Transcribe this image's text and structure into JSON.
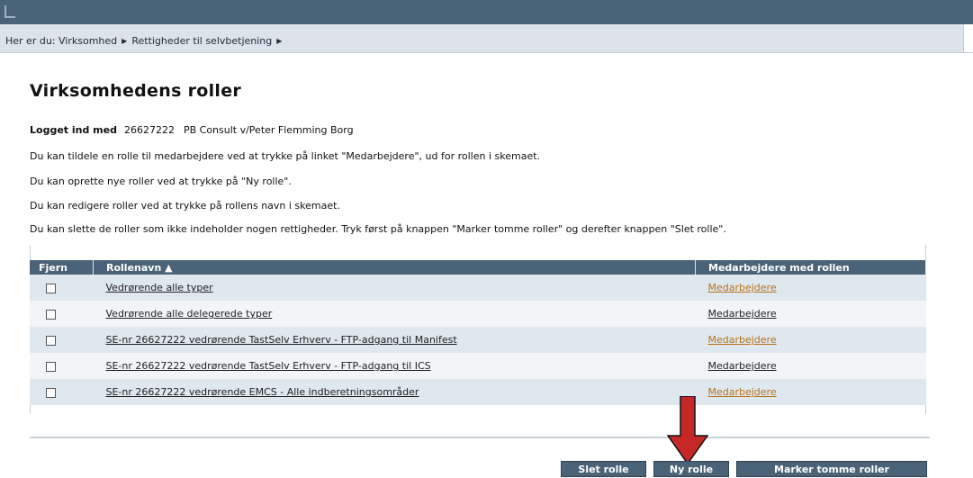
{
  "breadcrumb": {
    "prefix": "Her er du:",
    "items": [
      "Virksomhed",
      "Rettigheder til selvbetjening"
    ]
  },
  "page_title": "Virksomhedens roller",
  "logged_in": {
    "label": "Logget ind med",
    "id": "26627222",
    "name": "PB Consult v/Peter Flemming Borg"
  },
  "instructions": [
    "Du kan tildele en rolle til medarbejdere ved at trykke på linket \"Medarbejdere\", ud for rollen i skemaet.",
    "Du kan oprette nye roller ved at trykke på \"Ny rolle\".",
    "Du kan redigere roller ved at trykke på rollens navn i skemaet.",
    "Du kan slette de roller som ikke indeholder nogen rettigheder. Tryk først på knappen \"Marker tomme roller\" og derefter knappen \"Slet rolle\"."
  ],
  "table": {
    "columns": [
      "Fjern",
      "Rollenavn ▲",
      "Medarbejdere med rollen"
    ],
    "rows": [
      {
        "role": "Vedrørende alle typer",
        "employees": "Medarbejdere",
        "link_color": "orange"
      },
      {
        "role": "Vedrørende alle delegerede typer",
        "employees": "Medarbejdere",
        "link_color": "dark"
      },
      {
        "role": "SE-nr 26627222 vedrørende TastSelv Erhverv - FTP-adgang til Manifest",
        "employees": "Medarbejdere",
        "link_color": "orange"
      },
      {
        "role": "SE-nr 26627222 vedrørende TastSelv Erhverv - FTP-adgang til ICS",
        "employees": "Medarbejdere",
        "link_color": "dark"
      },
      {
        "role": "SE-nr 26627222 vedrørende EMCS - Alle indberetningsområder",
        "employees": "Medarbejdere",
        "link_color": "orange"
      }
    ]
  },
  "buttons": {
    "delete": "Slet rolle",
    "new": "Ny rolle",
    "mark_empty": "Marker tomme roller"
  },
  "colors": {
    "header_bg": "#4a6378",
    "row_odd": "#dfe7ef",
    "row_even": "#f2f5f8",
    "link_orange": "#b8731b",
    "arrow": "#c62828"
  }
}
